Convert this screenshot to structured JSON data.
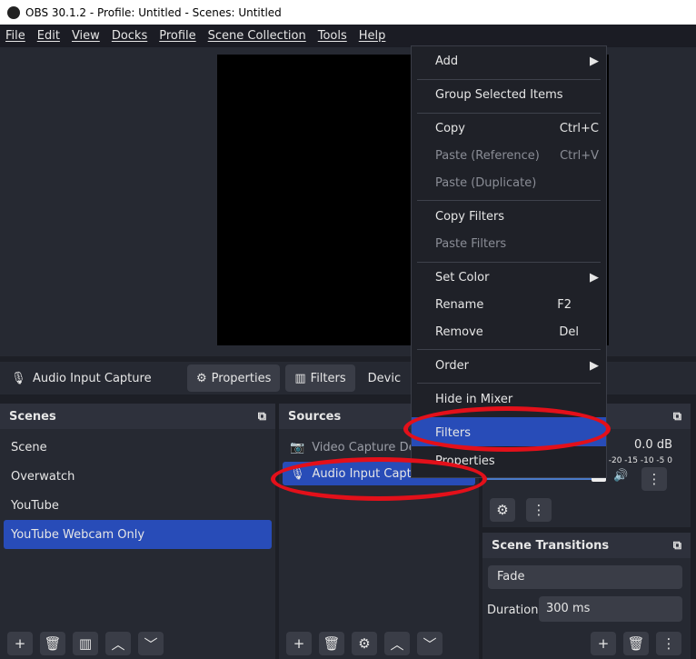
{
  "window": {
    "title": "OBS 30.1.2 - Profile: Untitled - Scenes: Untitled"
  },
  "menubar": [
    "File",
    "Edit",
    "View",
    "Docks",
    "Profile",
    "Scene Collection",
    "Tools",
    "Help"
  ],
  "source_toolbar": {
    "source_name": "Audio Input Capture",
    "properties": "Properties",
    "filters": "Filters",
    "device": "Devic"
  },
  "scenes": {
    "title": "Scenes",
    "items": [
      "Scene",
      "Overwatch",
      "YouTube",
      "YouTube Webcam Only"
    ],
    "selected": "YouTube Webcam Only"
  },
  "sources": {
    "title": "Sources",
    "items": [
      "Video Capture De",
      "Audio Input Captur"
    ]
  },
  "mixer": {
    "db": "0.0 dB",
    "scale": "-20 -15 -10 -5 0"
  },
  "transitions": {
    "title": "Scene Transitions",
    "transition": "Fade",
    "duration_label": "Duration",
    "duration": "300 ms"
  },
  "context_menu": {
    "add": "Add",
    "group": "Group Selected Items",
    "copy": "Copy",
    "copy_sc": "Ctrl+C",
    "paste_ref": "Paste (Reference)",
    "paste_ref_sc": "Ctrl+V",
    "paste_dup": "Paste (Duplicate)",
    "copy_filters": "Copy Filters",
    "paste_filters": "Paste Filters",
    "set_color": "Set Color",
    "rename": "Rename",
    "rename_sc": "F2",
    "remove": "Remove",
    "remove_sc": "Del",
    "order": "Order",
    "hide_mixer": "Hide in Mixer",
    "filters": "Filters",
    "properties": "Properties"
  },
  "colors": {
    "accent": "#284cb8",
    "annotation": "#e3101a"
  }
}
